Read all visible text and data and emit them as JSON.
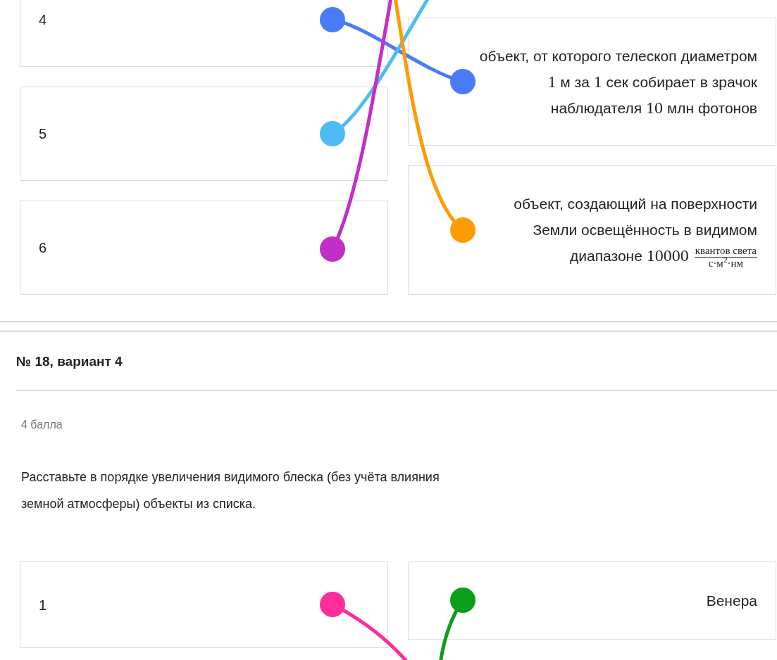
{
  "match_top": {
    "left_items": [
      {
        "label": "4"
      },
      {
        "label": "5"
      },
      {
        "label": "6"
      }
    ],
    "right_items": [
      {
        "segments": [
          {
            "kind": "text",
            "text": "объект, от которого телескоп диаметром "
          },
          {
            "kind": "math",
            "text": "1"
          },
          {
            "kind": "text",
            "text": " м за "
          },
          {
            "kind": "math",
            "text": "1"
          },
          {
            "kind": "text",
            "text": " сек собирает в зрачок наблюдателя "
          },
          {
            "kind": "math",
            "text": "10"
          },
          {
            "kind": "text",
            "text": " млн фотонов"
          }
        ]
      },
      {
        "segments": [
          {
            "kind": "text",
            "text": "объект, создающий на поверхности Земли освещённость в видимом диапазоне "
          },
          {
            "kind": "math",
            "text": "10000"
          },
          {
            "kind": "fraction",
            "numerator": "квантов света",
            "denominator": "с·м$^{2}$·нм"
          }
        ]
      }
    ],
    "connections": [
      {
        "color": "#4a7bf7"
      },
      {
        "color": "#4dbcf5"
      },
      {
        "color": "#c12fc8"
      },
      {
        "color": "#ff9a00"
      }
    ]
  },
  "question": {
    "title": "№ 18, вариант 4",
    "points": "4 балла",
    "text": "Расставьте в порядке увеличения видимого блеска (без учёта влияния земной атмосферы) объекты из списка.",
    "left_items": [
      {
        "label": "1"
      }
    ],
    "right_items": [
      {
        "label": "Венера"
      }
    ],
    "connections": [
      {
        "color": "#ff2d9b"
      },
      {
        "color": "#0a9e1a"
      }
    ]
  }
}
